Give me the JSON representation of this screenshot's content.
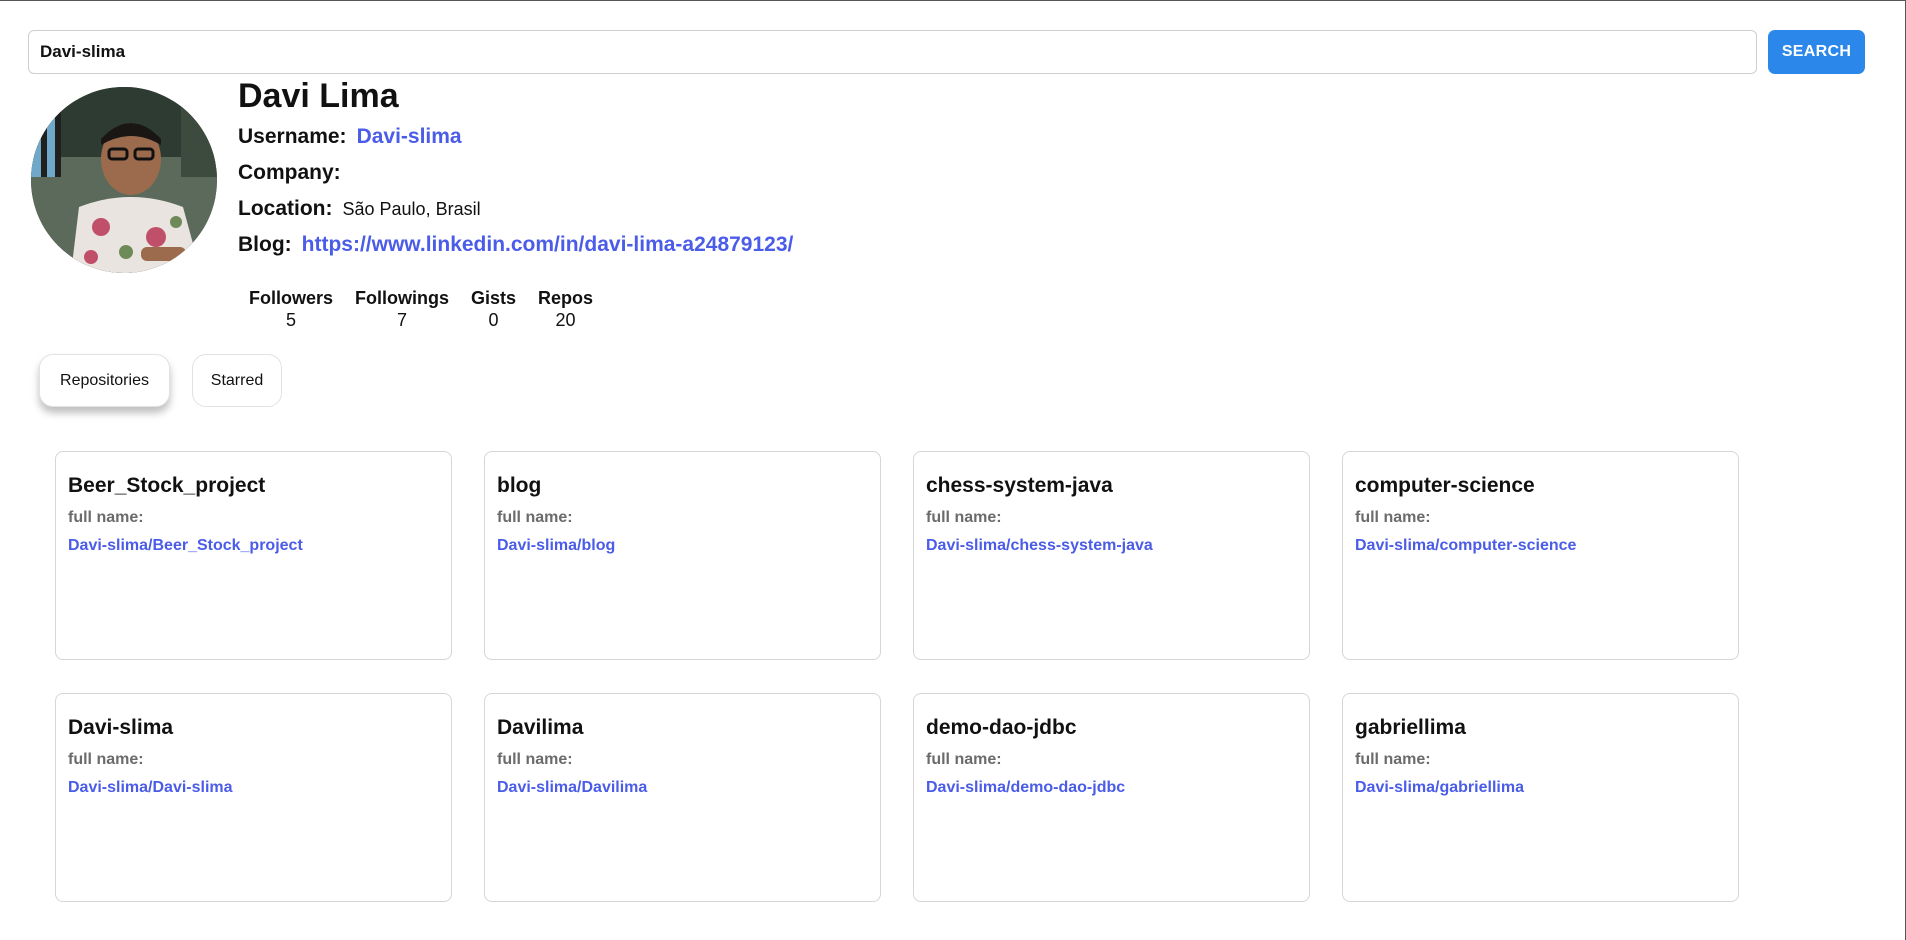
{
  "search": {
    "value": "Davi-slima",
    "button_label": "SEARCH"
  },
  "profile": {
    "name": "Davi Lima",
    "username_label": "Username:",
    "username": "Davi-slima",
    "company_label": "Company:",
    "company": "",
    "location_label": "Location:",
    "location": "São Paulo, Brasil",
    "blog_label": "Blog:",
    "blog": "https://www.linkedin.com/in/davi-lima-a24879123/"
  },
  "stats": [
    {
      "label": "Followers",
      "value": "5"
    },
    {
      "label": "Followings",
      "value": "7"
    },
    {
      "label": "Gists",
      "value": "0"
    },
    {
      "label": "Repos",
      "value": "20"
    }
  ],
  "tabs": [
    {
      "label": "Repositories",
      "active": true
    },
    {
      "label": "Starred",
      "active": false
    }
  ],
  "repos": [
    {
      "name": "Beer_Stock_project",
      "full_name_label": "full name:",
      "full_name": "Davi-slima/Beer_Stock_project"
    },
    {
      "name": "blog",
      "full_name_label": "full name:",
      "full_name": "Davi-slima/blog"
    },
    {
      "name": "chess-system-java",
      "full_name_label": "full name:",
      "full_name": "Davi-slima/chess-system-java"
    },
    {
      "name": "computer-science",
      "full_name_label": "full name:",
      "full_name": "Davi-slima/computer-science"
    },
    {
      "name": "Davi-slima",
      "full_name_label": "full name:",
      "full_name": "Davi-slima/Davi-slima"
    },
    {
      "name": "Davilima",
      "full_name_label": "full name:",
      "full_name": "Davi-slima/Davilima"
    },
    {
      "name": "demo-dao-jdbc",
      "full_name_label": "full name:",
      "full_name": "Davi-slima/demo-dao-jdbc"
    },
    {
      "name": "gabriellima",
      "full_name_label": "full name:",
      "full_name": "Davi-slima/gabriellima"
    }
  ],
  "colors": {
    "accent": "#2b87e9",
    "link": "#4a5ce8",
    "muted": "#6b6b6b"
  }
}
